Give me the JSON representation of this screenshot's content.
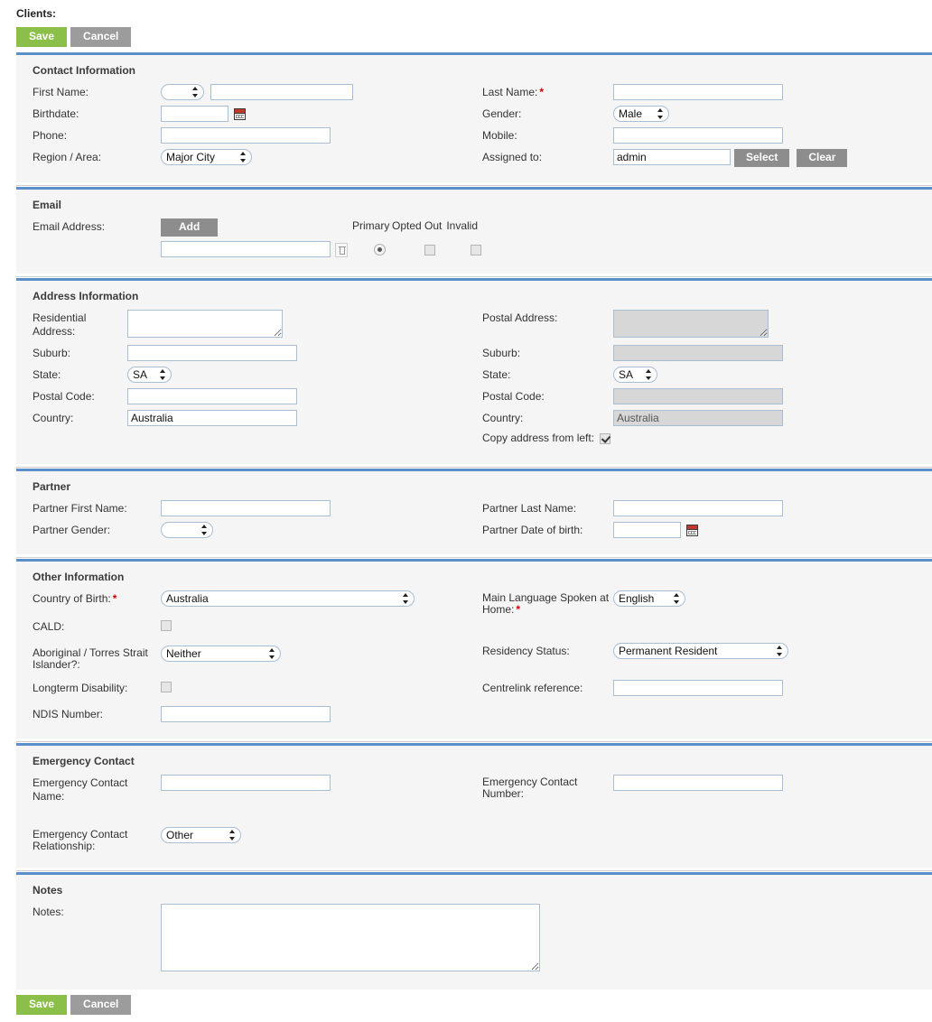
{
  "page": {
    "title": "Clients:"
  },
  "actions": {
    "save_label": "Save",
    "cancel_label": "Cancel"
  },
  "sections": {
    "contact": {
      "title": "Contact Information",
      "first_name_label": "First Name:",
      "first_name_title_value": "",
      "first_name_value": "",
      "birthdate_label": "Birthdate:",
      "birthdate_value": "",
      "phone_label": "Phone:",
      "phone_value": "",
      "region_label": "Region / Area:",
      "region_value": "Major City",
      "last_name_label": "Last Name:",
      "last_name_required": "*",
      "last_name_value": "",
      "gender_label": "Gender:",
      "gender_value": "Male",
      "mobile_label": "Mobile:",
      "mobile_value": "",
      "assigned_label": "Assigned to:",
      "assigned_value": "admin",
      "select_label": "Select",
      "clear_label": "Clear"
    },
    "email": {
      "title": "Email",
      "email_address_label": "Email Address:",
      "add_label": "Add",
      "primary_label": "Primary",
      "opted_out_label": "Opted Out",
      "invalid_label": "Invalid",
      "email_value": "",
      "primary_checked": true,
      "opted_out_checked": false,
      "invalid_checked": false
    },
    "address": {
      "title": "Address Information",
      "residential_label": "Residential Address:",
      "residential_value": "",
      "suburb_label": "Suburb:",
      "suburb_value": "",
      "state_label": "State:",
      "state_value": "SA",
      "postcode_label": "Postal Code:",
      "postcode_value": "",
      "country_label": "Country:",
      "country_value": "Australia",
      "postal_label": "Postal Address:",
      "postal_value": "",
      "postal_suburb_label": "Suburb:",
      "postal_suburb_value": "",
      "postal_state_label": "State:",
      "postal_state_value": "SA",
      "postal_postcode_label": "Postal Code:",
      "postal_postcode_value": "",
      "postal_country_label": "Country:",
      "postal_country_value": "Australia",
      "copy_label": "Copy address from left:",
      "copy_checked": true
    },
    "partner": {
      "title": "Partner",
      "first_name_label": "Partner First Name:",
      "first_name_value": "",
      "gender_label": "Partner Gender:",
      "gender_value": "",
      "last_name_label": "Partner Last Name:",
      "last_name_value": "",
      "dob_label": "Partner Date of birth:",
      "dob_value": ""
    },
    "other": {
      "title": "Other Information",
      "country_birth_label": "Country of Birth:",
      "country_birth_required": "*",
      "country_birth_value": "Australia",
      "cald_label": "CALD:",
      "cald_checked": false,
      "atsi_label": "Aboriginal / Torres Strait Islander?:",
      "atsi_value": "Neither",
      "disability_label": "Longterm Disability:",
      "disability_checked": false,
      "ndis_label": "NDIS Number:",
      "ndis_value": "",
      "language_label": "Main Language Spoken at Home:",
      "language_required": "*",
      "language_value": "English",
      "residency_label": "Residency Status:",
      "residency_value": "Permanent Resident",
      "centrelink_label": "Centrelink reference:",
      "centrelink_value": ""
    },
    "emergency": {
      "title": "Emergency Contact",
      "name_label": "Emergency Contact Name:",
      "name_value": "",
      "relationship_label": "Emergency Contact Relationship:",
      "relationship_value": "Other",
      "number_label": "Emergency Contact Number:",
      "number_value": ""
    },
    "notes": {
      "title": "Notes",
      "notes_label": "Notes:",
      "notes_value": ""
    }
  },
  "colors": {
    "save_green": "#8cbf4a",
    "cancel_grey": "#9c9c9c",
    "divider_blue": "#5b8fc9",
    "panel_bg": "#f5f5f5",
    "required_red": "#d10000",
    "disabled_bg": "#d7d7d7"
  }
}
